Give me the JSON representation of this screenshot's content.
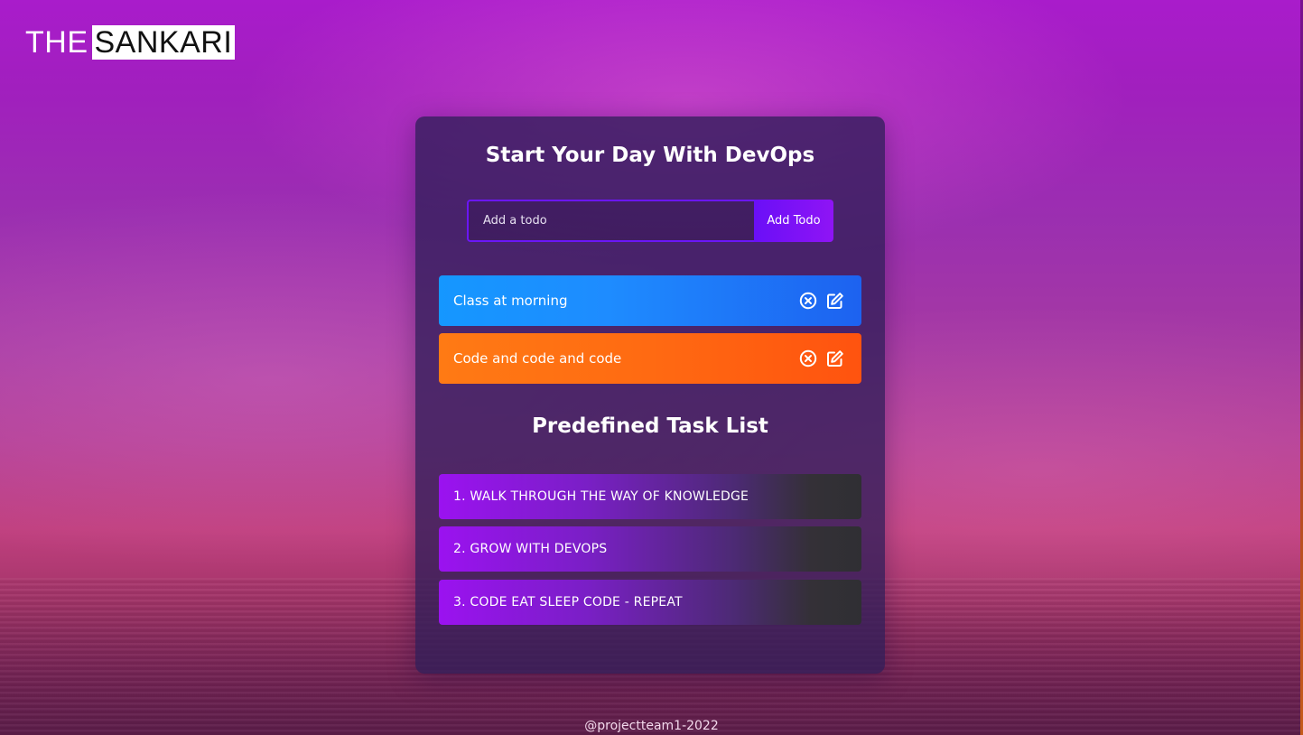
{
  "logo": {
    "part1": "THE",
    "part2": "SANKARI"
  },
  "card": {
    "title": "Start Your Day With DevOps",
    "form": {
      "placeholder": "Add a todo",
      "value": "",
      "button_label": "Add Todo"
    },
    "todos": [
      {
        "text": "Class at morning",
        "color": "#1e8cff"
      },
      {
        "text": "Code and code and code",
        "color": "#ff6a12"
      }
    ],
    "predefined_title": "Predefined Task List",
    "tasks": [
      "1. WALK THROUGH THE WAY OF KNOWLEDGE",
      "2. GROW WITH DEVOPS",
      "3. CODE EAT SLEEP CODE - REPEAT"
    ]
  },
  "icons": {
    "delete": "close-circle-icon",
    "edit": "edit-icon"
  },
  "footer": {
    "text": "@projectteam1-2022"
  },
  "colors": {
    "accent": "#6a0ff7",
    "card_bg": "#301e58"
  }
}
